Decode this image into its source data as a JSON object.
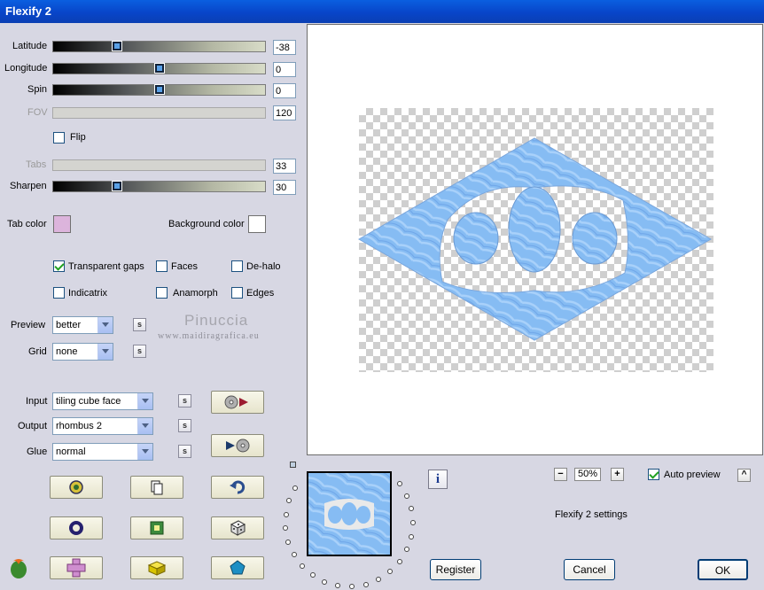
{
  "window": {
    "title": "Flexify 2"
  },
  "sliders": [
    {
      "label": "Latitude",
      "value": "-38",
      "level": 0.3,
      "enabled": true
    },
    {
      "label": "Longitude",
      "value": "0",
      "level": 0.5,
      "enabled": true
    },
    {
      "label": "Spin",
      "value": "0",
      "level": 0.5,
      "enabled": true
    },
    {
      "label": "FOV",
      "value": "120",
      "enabled": false
    },
    {
      "label": "Tabs",
      "value": "33",
      "enabled": false
    },
    {
      "label": "Sharpen",
      "value": "30",
      "level": 0.3,
      "enabled": true
    }
  ],
  "flip": {
    "label": "Flip",
    "checked": false
  },
  "colors": {
    "tab_label": "Tab color",
    "tab_value": "#dcb4dc",
    "bg_label": "Background color",
    "bg_value": "#ffffff"
  },
  "options": {
    "transparent_gaps": {
      "label": "Transparent gaps",
      "checked": true
    },
    "faces": {
      "label": "Faces",
      "checked": false
    },
    "de_halo": {
      "label": "De-halo",
      "checked": false
    },
    "indicatrix": {
      "label": "Indicatrix",
      "checked": false
    },
    "anamorph": {
      "label": "Anamorph",
      "checked": false
    },
    "edges": {
      "label": "Edges",
      "checked": false
    }
  },
  "preview_quality": {
    "label": "Preview",
    "value": "better"
  },
  "grid": {
    "label": "Grid",
    "value": "none"
  },
  "sync_label": "s",
  "watermark": {
    "name": "Pinuccia",
    "url": "www.maidiragrafica.eu"
  },
  "input": {
    "label": "Input",
    "value": "tiling cube face"
  },
  "output": {
    "label": "Output",
    "value": "rhombus 2"
  },
  "glue": {
    "label": "Glue",
    "value": "normal"
  },
  "zoom": {
    "value": "50%",
    "minus": "−",
    "plus": "+"
  },
  "auto_preview": {
    "label": "Auto preview",
    "checked": true,
    "toggle": "^"
  },
  "info_icon_label": "i",
  "settings_name": "Flexify 2 settings",
  "buttons": {
    "register": "Register",
    "cancel": "Cancel",
    "ok": "OK"
  },
  "accent_colors": {
    "shape": "#7fb6f2",
    "shape_dark": "#5a96e0",
    "title_bar": "#0845c9"
  }
}
